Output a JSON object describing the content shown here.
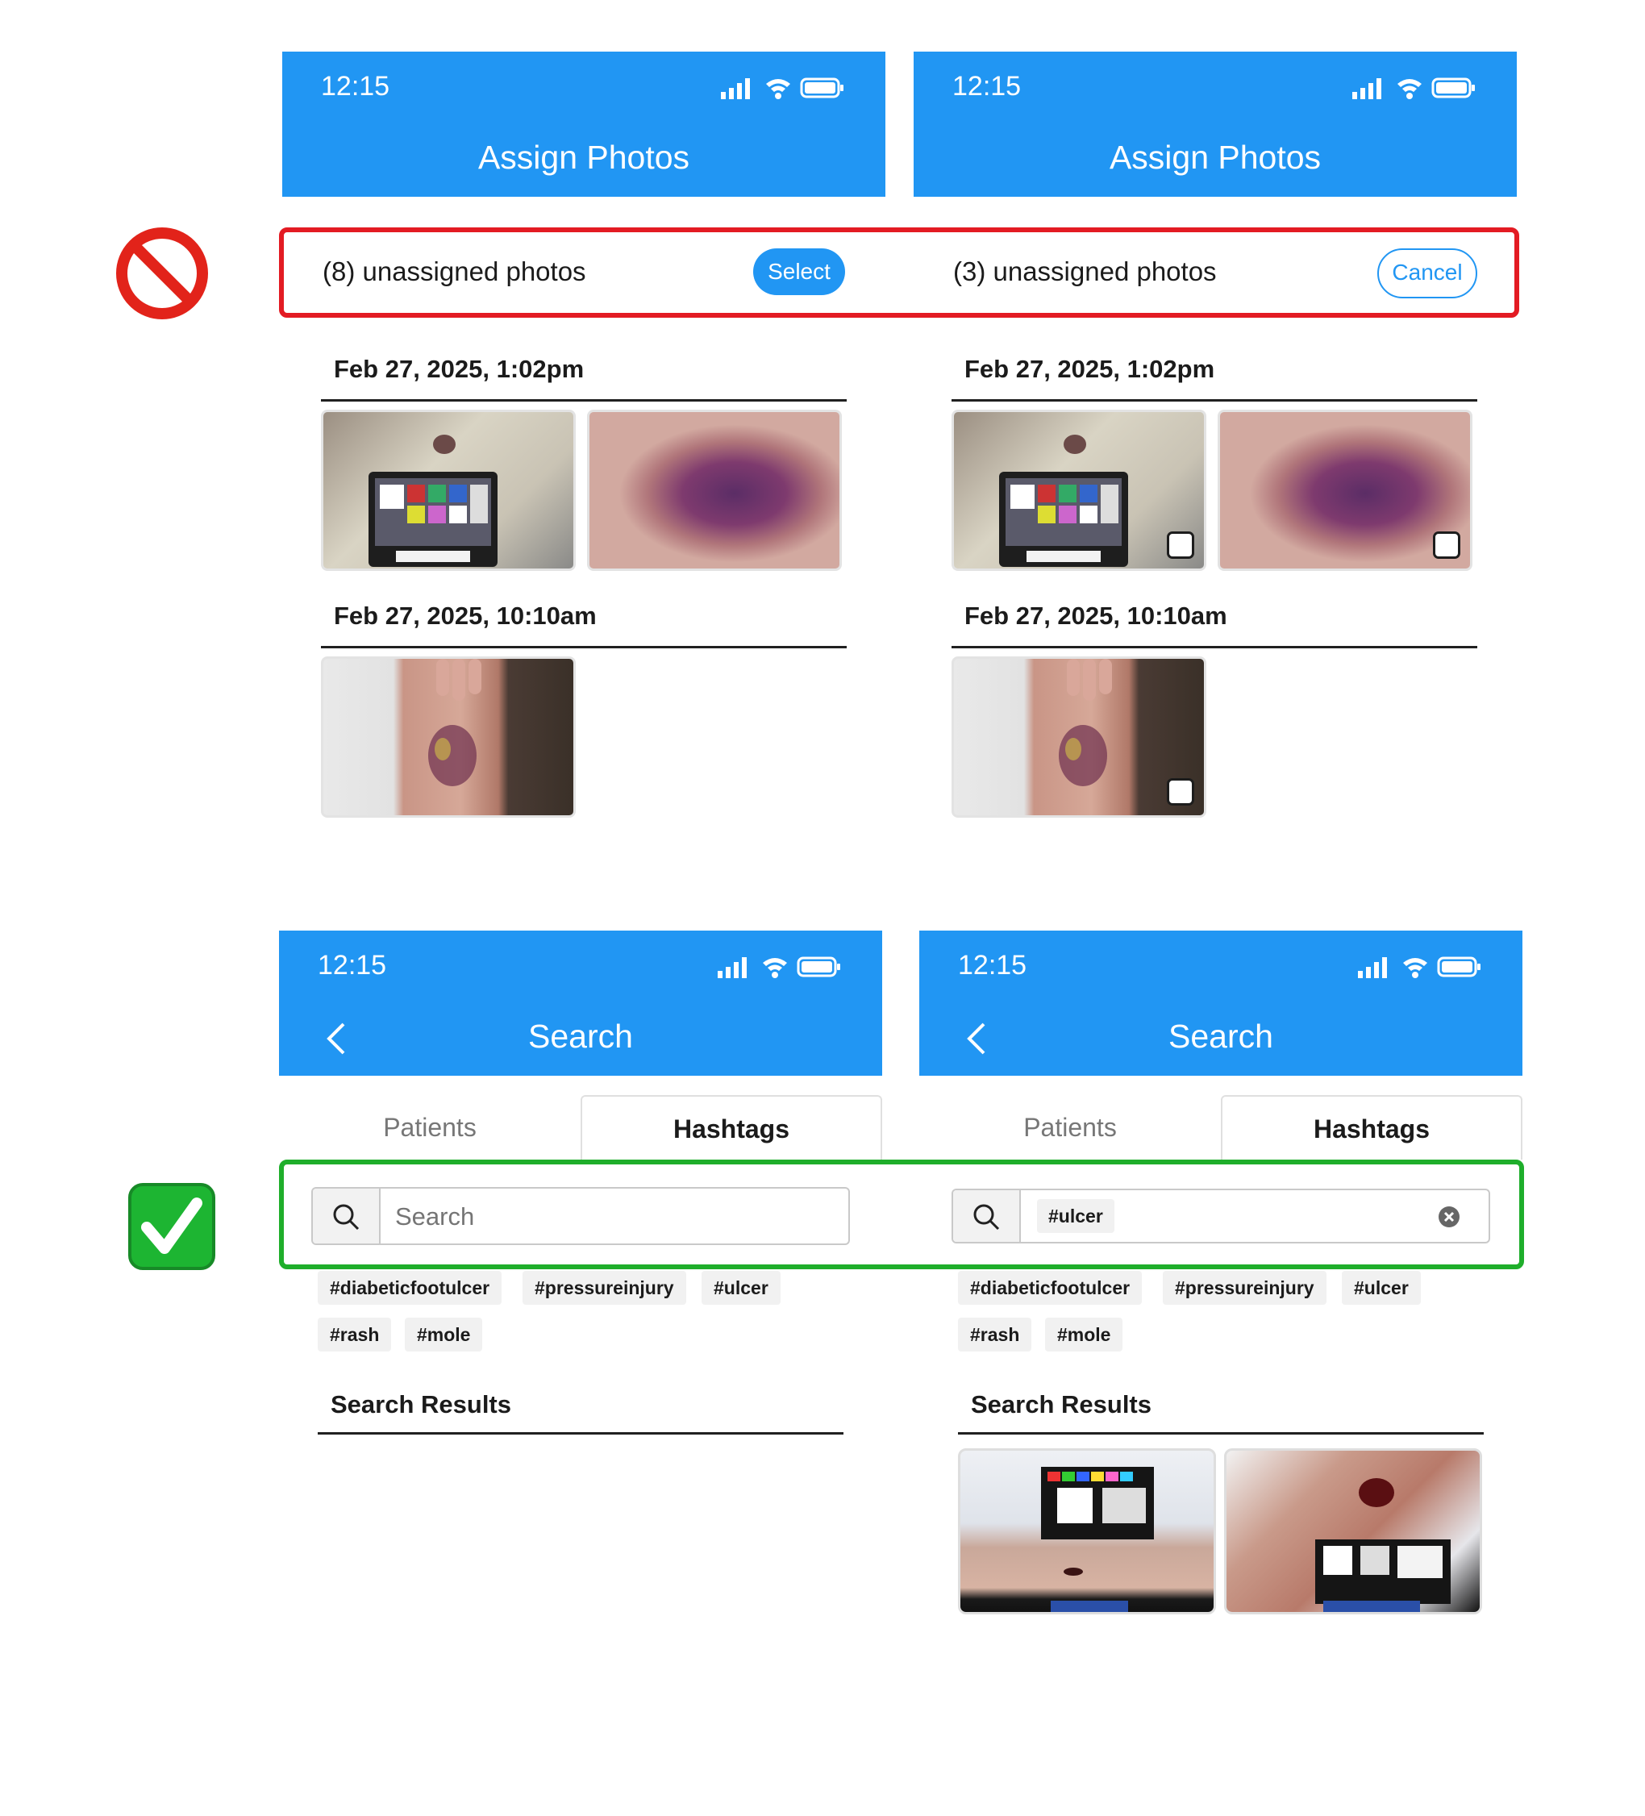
{
  "status_bar": {
    "time": "12:15"
  },
  "assign_screens": [
    {
      "title": "Assign Photos",
      "count_text": "(8) unassigned photos",
      "action_label": "Select"
    },
    {
      "title": "Assign Photos",
      "count_text": "(3) unassigned photos",
      "action_label": "Cancel"
    }
  ],
  "assign_groups": [
    "Feb 27, 2025, 1:02pm",
    "Feb 27, 2025, 10:10am"
  ],
  "search_screens": [
    {
      "title": "Search",
      "tabs": [
        "Patients",
        "Hashtags"
      ],
      "active_tab": "Hashtags",
      "input_placeholder": "Search",
      "input_value": ""
    },
    {
      "title": "Search",
      "tabs": [
        "Patients",
        "Hashtags"
      ],
      "active_tab": "Hashtags",
      "input_placeholder": "",
      "input_value": "#ulcer"
    }
  ],
  "hashtags": [
    "#diabeticfootulcer",
    "#pressureinjury",
    "#ulcer",
    "#rash",
    "#mole"
  ],
  "search_results_label": "Search Results",
  "colors": {
    "header_blue": "#2196f3",
    "bad_frame": "#e31b23",
    "good_frame": "#1fae2b"
  },
  "icons": {
    "bad": "prohibited-icon",
    "good": "check-mark-button-icon"
  }
}
